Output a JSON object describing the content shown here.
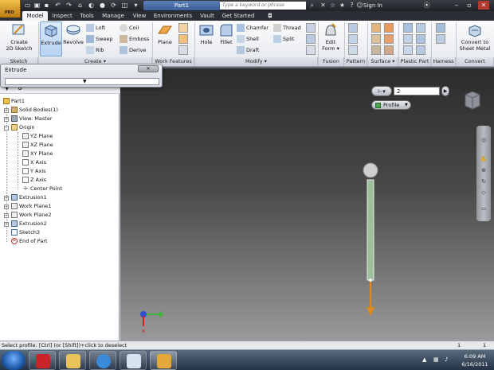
{
  "titlebar": {
    "doc_title": "Part1",
    "search_placeholder": "Type a keyword or phrase",
    "signin": "Sign In"
  },
  "tabs": [
    "Model",
    "Inspect",
    "Tools",
    "Manage",
    "View",
    "Environments",
    "Vault",
    "Get Started"
  ],
  "ribbon": {
    "sketch": {
      "create_label_1": "Create",
      "create_label_2": "2D Sketch",
      "panel": "Sketch"
    },
    "create": {
      "extrude": "Extrude",
      "revolve": "Revolve",
      "loft": "Loft",
      "sweep": "Sweep",
      "rib": "Rib",
      "coil": "Coil",
      "emboss": "Emboss",
      "derive": "Derive",
      "panel": "Create"
    },
    "work_features": {
      "plane": "Plane",
      "panel": "Work Features"
    },
    "modify": {
      "hole": "Hole",
      "fillet": "Fillet",
      "chamfer": "Chamfer",
      "shell": "Shell",
      "draft": "Draft",
      "thread": "Thread",
      "split": "Split",
      "panel": "Modify"
    },
    "fusion": {
      "edit_form_1": "Edit",
      "edit_form_2": "Form",
      "panel": "Fusion"
    },
    "pattern": {
      "panel": "Pattern"
    },
    "surface": {
      "panel": "Surface"
    },
    "plastic": {
      "panel": "Plastic Part"
    },
    "harness": {
      "panel": "Harness"
    },
    "convert": {
      "label_1": "Convert to",
      "label_2": "Sheet Metal",
      "panel": "Convert"
    }
  },
  "extrude_dialog": {
    "title": "Extrude"
  },
  "browser": {
    "items": [
      {
        "label": "Part1"
      },
      {
        "label": "Solid Bodies(1)"
      },
      {
        "label": "View: Master"
      },
      {
        "label": "Origin"
      },
      {
        "label": "YZ Plane"
      },
      {
        "label": "XZ Plane"
      },
      {
        "label": "XY Plane"
      },
      {
        "label": "X Axis"
      },
      {
        "label": "Y Axis"
      },
      {
        "label": "Z Axis"
      },
      {
        "label": "Center Point"
      },
      {
        "label": "Extrusion1"
      },
      {
        "label": "Work Plane1"
      },
      {
        "label": "Work Plane2"
      },
      {
        "label": "Extrusion2"
      },
      {
        "label": "Sketch3"
      },
      {
        "label": "End of Part"
      }
    ]
  },
  "viewport": {
    "count_value": "2",
    "profile_label": "Profile"
  },
  "status": {
    "message": "Select profile. [Ctrl] (or [Shift])+click to deselect",
    "count1": "1",
    "count2": "1"
  },
  "taskbar": {
    "time": "6:09 AM",
    "date": "6/16/2011"
  },
  "colors": {
    "active_tab_bg": "#f3f5f8",
    "selection_blue": "#7ca3d6",
    "viewport_top": "#2b2b2c",
    "model_green": "#9dbf9b",
    "arrow_orange": "#e08a1e"
  }
}
